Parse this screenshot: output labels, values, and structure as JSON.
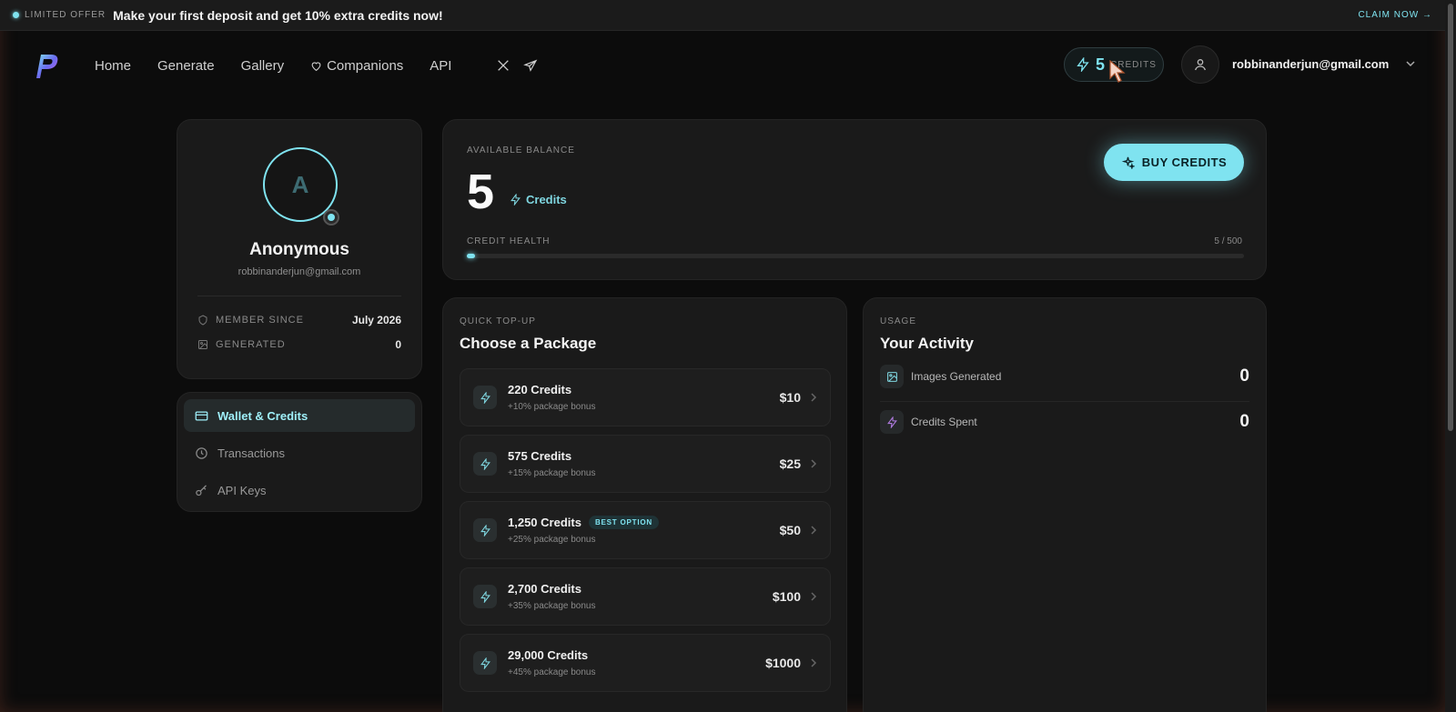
{
  "promo": {
    "tag": "LIMITED OFFER",
    "message": "Make your first deposit and get 10% extra credits now!",
    "cta": "CLAIM NOW →"
  },
  "nav": {
    "links": [
      "Home",
      "Generate",
      "Gallery",
      "Companions",
      "API"
    ],
    "credits_value": "5",
    "credits_label": "CREDITS",
    "user_email": "robbinanderjun@gmail.com"
  },
  "profile": {
    "initial": "A",
    "name": "Anonymous",
    "email": "robbinanderjun@gmail.com",
    "stats": [
      {
        "label": "MEMBER SINCE",
        "value": "July 2026"
      },
      {
        "label": "GENERATED",
        "value": "0"
      }
    ]
  },
  "menu": {
    "items": [
      "Wallet & Credits",
      "Transactions",
      "API Keys"
    ],
    "active": "Wallet & Credits"
  },
  "balance": {
    "label": "AVAILABLE BALANCE",
    "value": "5",
    "unit": "Credits",
    "buy_label": "BUY CREDITS",
    "health_label": "CREDIT HEALTH",
    "health_text": "5 / 500",
    "health_fraction": 0.01
  },
  "packages": {
    "eyebrow": "QUICK TOP-UP",
    "title": "Choose a Package",
    "items": [
      {
        "name": "220 Credits",
        "bonus": "+10% package bonus",
        "price": "$10",
        "badge": ""
      },
      {
        "name": "575 Credits",
        "bonus": "+15% package bonus",
        "price": "$25",
        "badge": ""
      },
      {
        "name": "1,250 Credits",
        "bonus": "+25% package bonus",
        "price": "$50",
        "badge": "BEST OPTION"
      },
      {
        "name": "2,700 Credits",
        "bonus": "+35% package bonus",
        "price": "$100",
        "badge": ""
      },
      {
        "name": "29,000 Credits",
        "bonus": "+45% package bonus",
        "price": "$1000",
        "badge": ""
      }
    ]
  },
  "activity": {
    "eyebrow": "USAGE",
    "title": "Your Activity",
    "rows": [
      {
        "label": "Images Generated",
        "value": "0"
      },
      {
        "label": "Credits Spent",
        "value": "0"
      }
    ]
  },
  "colors": {
    "accent": "#7fe3f0",
    "background": "#0c0c0c",
    "card": "#1a1a1a",
    "purple_icon": "#b07be0"
  },
  "icons": [
    "logo-icon",
    "heart-icon",
    "x-twitter-icon",
    "telegram-icon",
    "bolt-icon",
    "user-icon",
    "chevron-down-icon",
    "shield-icon",
    "image-icon",
    "wallet-icon",
    "clock-icon",
    "key-icon",
    "sparkle-icon",
    "chevron-right-icon"
  ]
}
